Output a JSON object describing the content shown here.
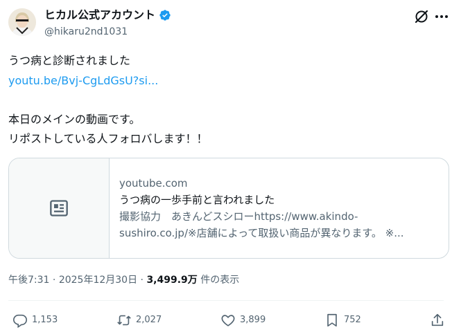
{
  "author": {
    "display_name": "ヒカル公式アカウント",
    "handle": "@hikaru2nd1031",
    "avatar_icon": "profile-photo",
    "verified_color": "#1d9bf0"
  },
  "post": {
    "line1": "うつ病と診断されました",
    "link_text": "youtu.be/Bvj-CgLdGsU?si...",
    "line3": "本日のメインの動画です。",
    "line4": "リポストしている人フォロバします！！"
  },
  "card": {
    "domain": "youtube.com",
    "title": "うつ病の一歩手前と言われました",
    "desc_line1": "撮影協力　あきんどスシローhttps://www.akindo-",
    "desc_line2": "sushiro.co.jp/※店舗によって取扱い商品が異なります。 ※...",
    "thumb_icon": "article-placeholder-icon"
  },
  "meta": {
    "time": "午後7:31",
    "sep1": " · ",
    "date": "2025年12月30日",
    "sep2": " · ",
    "views": "3,499.9万",
    "views_suffix": " 件の表示"
  },
  "actions": {
    "replies": "1,153",
    "reposts": "2,027",
    "likes": "3,899",
    "bookmarks": "752"
  },
  "colors": {
    "link": "#1d9bf0",
    "secondary_text": "#536471",
    "border": "#cfd9de"
  }
}
